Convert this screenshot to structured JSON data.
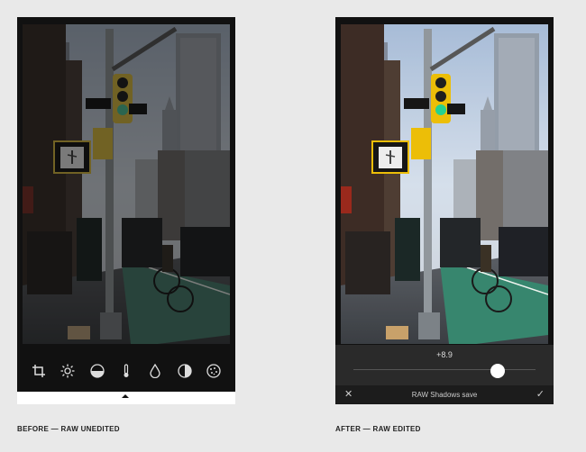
{
  "captions": {
    "before": "BEFORE — RAW UNEDITED",
    "after": "AFTER — RAW EDITED"
  },
  "tools": [
    {
      "icon": "crop-icon"
    },
    {
      "icon": "brightness-icon"
    },
    {
      "icon": "exposure-icon"
    },
    {
      "icon": "temperature-icon"
    },
    {
      "icon": "saturation-drop-icon"
    },
    {
      "icon": "contrast-icon"
    },
    {
      "icon": "grain-icon"
    }
  ],
  "editor": {
    "value": "+8.9",
    "label": "RAW Shadows save",
    "cancel": "✕",
    "confirm": "✓",
    "slider_level": 0.79
  }
}
